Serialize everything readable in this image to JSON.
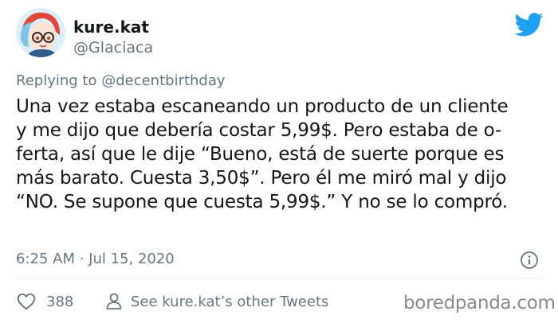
{
  "author": {
    "display_name": "kure.kat",
    "handle": "@Glaciaca",
    "avatar_icon": "anime-girl-avatar"
  },
  "brand_icon": "twitter-bird-icon",
  "reply": {
    "text": "Replying to @decentbirthday"
  },
  "tweet": {
    "lines": [
      "Una vez estaba escaneando un producto de un cliente",
      "y me dijo que debería costar 5,99$. Pero estaba de o-",
      "ferta, así que le dije “Bueno, está de suerte porque es",
      "más barato. Cuesta 3,50$”. Pero él me miró mal y dijo",
      "“NO. Se supone que cuesta 5,99$.” Y no se lo compró."
    ],
    "timestamp": "6:25 AM · Jul 15, 2020"
  },
  "actions": {
    "likes": "388",
    "other_tweets_label": "See kure.kat’s other Tweets"
  },
  "watermark": "boredpanda.com",
  "colors": {
    "twitter_blue": "#1da1f2",
    "text_primary": "#14171a",
    "text_secondary": "#657786",
    "divider": "#e6ecf0"
  }
}
